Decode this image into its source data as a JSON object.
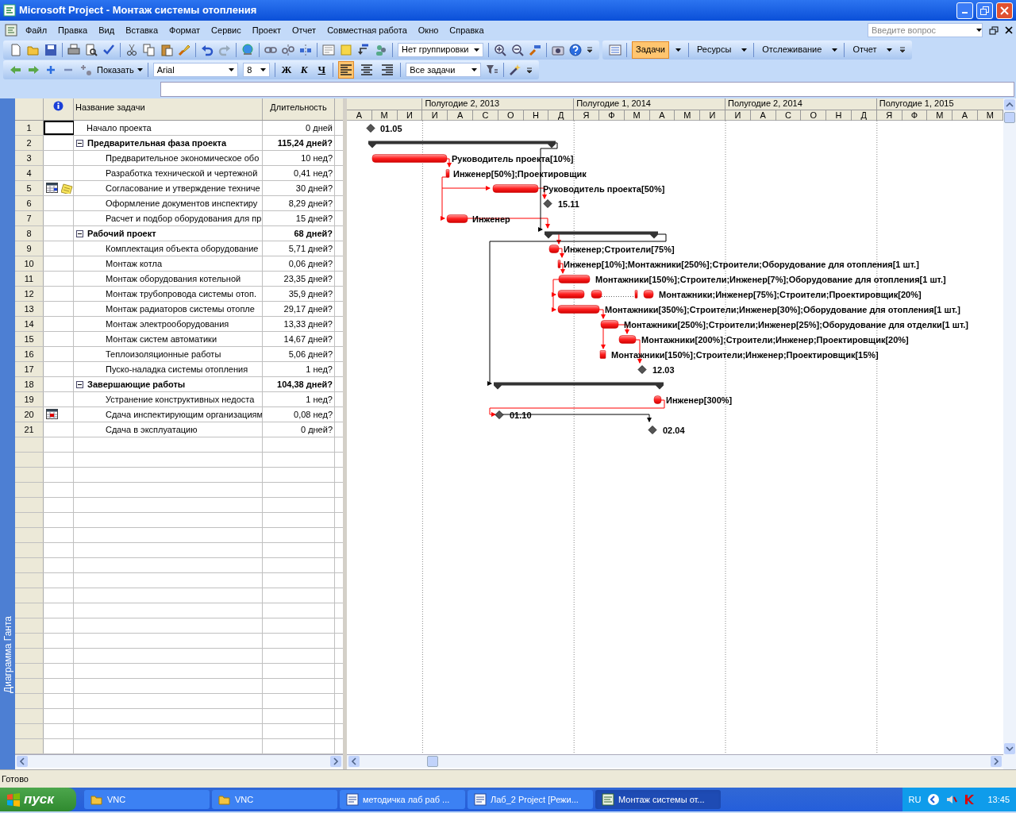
{
  "window": {
    "title": "Microsoft Project - Монтаж системы отопления"
  },
  "menu": [
    "Файл",
    "Правка",
    "Вид",
    "Вставка",
    "Формат",
    "Сервис",
    "Проект",
    "Отчет",
    "Совместная работа",
    "Окно",
    "Справка"
  ],
  "help_search": {
    "placeholder": "Введите вопрос"
  },
  "toolbar": {
    "grouping": "Нет группировки",
    "guide_buttons": [
      {
        "label": "Задачи",
        "selected": true
      },
      {
        "label": "Ресурсы",
        "selected": false
      },
      {
        "label": "Отслеживание",
        "selected": false
      },
      {
        "label": "Отчет",
        "selected": false
      }
    ],
    "outline_show": "Показать",
    "font": "Arial",
    "font_size": "8",
    "format_buttons": [
      {
        "label": "Ж",
        "kind": "bold"
      },
      {
        "label": "К",
        "kind": "italic"
      },
      {
        "label": "Ч",
        "kind": "underline"
      }
    ],
    "alignment": [
      {
        "kind": "left",
        "selected": true
      },
      {
        "kind": "center",
        "selected": false
      },
      {
        "kind": "right",
        "selected": false
      }
    ],
    "filter": "Все задачи"
  },
  "view_bar": {
    "label": "Диаграмма Ганта"
  },
  "table": {
    "columns": [
      "Название задачи",
      "Длительность"
    ],
    "tasks": [
      {
        "id": "1",
        "name": "Начало проекта",
        "duration": "0 дней",
        "selected": true,
        "bar": {
          "kind": "milestone",
          "label": "01.05"
        }
      },
      {
        "id": "2",
        "name": "Предварительная фаза проекта",
        "duration": "115,24 дней?",
        "selected": false,
        "expanded": true,
        "bar": {
          "kind": "summary"
        },
        "children": [
          {
            "id": "3",
            "name": "Предварительное экономическое обо",
            "duration": "10 нед?",
            "selected": false,
            "bar": {
              "kind": "bar",
              "label": "Руководитель проекта[10%]"
            }
          },
          {
            "id": "4",
            "name": "Разработка технической и чертежной",
            "duration": "0,41 нед?",
            "selected": false,
            "bar": {
              "kind": "bar",
              "label": "Инженер[50%];Проектировщик"
            }
          },
          {
            "id": "5",
            "name": "Согласование и утверждение техниче",
            "duration": "30 дней?",
            "selected": false,
            "indicators": [
              {
                "kind": "calendar"
              },
              {
                "kind": "note"
              }
            ],
            "bar": {
              "kind": "bar",
              "label": "Руководитель проекта[50%]"
            }
          },
          {
            "id": "6",
            "name": "Оформление документов инспектиру",
            "duration": "8,29 дней?",
            "selected": false,
            "bar": {
              "kind": "milestone",
              "label": "15.11"
            }
          },
          {
            "id": "7",
            "name": "Расчет и подбор оборудования для пр",
            "duration": "15 дней?",
            "selected": false,
            "bar": {
              "kind": "bar",
              "label": "Инженер"
            }
          }
        ]
      },
      {
        "id": "8",
        "name": "Рабочий проект",
        "duration": "68 дней?",
        "selected": false,
        "expanded": true,
        "bar": {
          "kind": "summary"
        },
        "children": [
          {
            "id": "9",
            "name": "Комплектация объекта оборудование",
            "duration": "5,71 дней?",
            "selected": false,
            "bar": {
              "kind": "bar",
              "label": "Инженер;Строители[75%]"
            }
          },
          {
            "id": "10",
            "name": "Монтаж котла",
            "duration": "0,06 дней?",
            "selected": false,
            "bar": {
              "kind": "bar",
              "label": "Инженер[10%];Монтажники[250%];Строители;Оборудование для отопления[1 шт.]"
            }
          },
          {
            "id": "11",
            "name": "Монтаж оборудования котельной",
            "duration": "23,35 дней?",
            "selected": false,
            "bar": {
              "kind": "bar",
              "label": "Монтажники[150%];Строители;Инженер[7%];Оборудование для отопления[1 шт.]"
            }
          },
          {
            "id": "12",
            "name": "Монтаж трубопровода системы отоп.",
            "duration": "35,9 дней?",
            "selected": false,
            "bar": {
              "kind": "split",
              "label": "Монтажники;Инженер[75%];Строители;Проектировщик[20%]"
            }
          },
          {
            "id": "13",
            "name": "Монтаж радиаторов системы отопле",
            "duration": "29,17 дней?",
            "selected": false,
            "bar": {
              "kind": "bar",
              "label": "Монтажники[350%];Строители;Инженер[30%];Оборудование для отопления[1 шт.]"
            }
          },
          {
            "id": "14",
            "name": "Монтаж электрооборудования",
            "duration": "13,33 дней?",
            "selected": false,
            "bar": {
              "kind": "bar",
              "label": "Монтажники[250%];Строители;Инженер[25%];Оборудование для отделки[1 шт.]"
            }
          },
          {
            "id": "15",
            "name": "Монтаж систем автоматики",
            "duration": "14,67 дней?",
            "selected": false,
            "bar": {
              "kind": "bar",
              "label": "Монтажники[200%];Строители;Инженер;Проектировщик[20%]"
            }
          },
          {
            "id": "16",
            "name": "Теплоизоляционные работы",
            "duration": "5,06 дней?",
            "selected": false,
            "bar": {
              "kind": "bar",
              "label": "Монтажники[150%];Строители;Инженер;Проектировщик[15%]"
            }
          },
          {
            "id": "17",
            "name": "Пуско-наладка системы отопления",
            "duration": "1 нед?",
            "selected": false,
            "bar": {
              "kind": "milestone",
              "label": "12.03"
            }
          }
        ]
      },
      {
        "id": "18",
        "name": "Завершающие работы",
        "duration": "104,38 дней?",
        "selected": false,
        "expanded": true,
        "bar": {
          "kind": "summary"
        },
        "children": [
          {
            "id": "19",
            "name": "Устранение конструктивных недоста",
            "duration": "1 нед?",
            "selected": false,
            "bar": {
              "kind": "bar",
              "label": "Инженер[300%]"
            }
          },
          {
            "id": "20",
            "name": "Сдача инспектирующим организациям",
            "duration": "0,08 нед?",
            "selected": false,
            "indicators": [
              {
                "kind": "constraint"
              }
            ],
            "bar": {
              "kind": "milestone",
              "label": "01.10"
            }
          },
          {
            "id": "21",
            "name": "Сдача в эксплуатацию",
            "duration": "0 дней?",
            "selected": false,
            "bar": {
              "kind": "milestone",
              "label": "02.04"
            }
          }
        ]
      }
    ]
  },
  "timescale": {
    "halves": [
      "Полугодие 2, 2013",
      "Полугодие 1, 2014",
      "Полугодие 2, 2014",
      "Полугодие 1, 2015"
    ],
    "months": [
      "А",
      "М",
      "И",
      "И",
      "А",
      "С",
      "О",
      "Н",
      "Д",
      "Я",
      "Ф",
      "М",
      "А",
      "М",
      "И",
      "И",
      "А",
      "С",
      "О",
      "Н",
      "Д",
      "Я",
      "Ф",
      "М",
      "А",
      "М"
    ]
  },
  "status_bar": {
    "text": "Готово"
  },
  "taskbar": {
    "start": "пуск",
    "windows": [
      {
        "label": "VNC",
        "kind": "folder",
        "active": false
      },
      {
        "label": "VNC",
        "kind": "folder",
        "active": false
      },
      {
        "label": "методичка лаб раб ...",
        "kind": "document",
        "active": false
      },
      {
        "label": "Лаб_2 Project [Режи...",
        "kind": "document",
        "active": false
      },
      {
        "label": "Монтаж системы от...",
        "kind": "project",
        "active": true
      }
    ],
    "language": "RU",
    "clock": "13:45"
  }
}
